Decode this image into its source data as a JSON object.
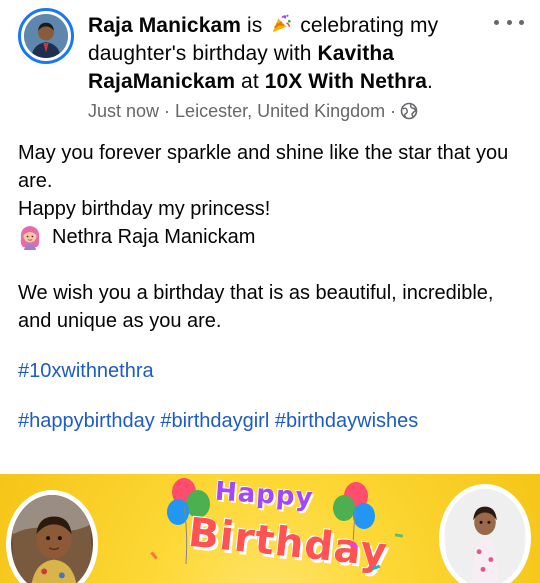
{
  "header": {
    "author": "Raja Manickam",
    "connector_is": " is ",
    "activity": " celebrating my daughter's birthday with ",
    "tagged_person": "Kavitha RajaManickam",
    "connector_at": " at ",
    "place": "10X With Nethra",
    "period": ".",
    "activity_icon": "party-popper-icon",
    "time": "Just now",
    "separator": " · ",
    "location": "Leicester, United Kingdom",
    "separator2": " ·",
    "audience_icon": "globe-icon",
    "more_icon": "more-options-icon"
  },
  "body": {
    "line1": "May you forever sparkle and shine like the star that you are.",
    "line2": "Happy birthday my princess!",
    "line3_icon": "girl-emoji-icon",
    "line3": "Nethra Raja Manickam",
    "line4": "We wish you a birthday that is as beautiful, incredible, and unique as you are.",
    "hashtag1": "#10xwithnethra",
    "hashtags": [
      "#happybirthday",
      "#birthdaygirl",
      "#birthdaywishes"
    ]
  },
  "image": {
    "happy": "Happy",
    "birthday": "Birthday",
    "colors": {
      "background": "#fdd835",
      "happy": "#a347ff",
      "birthday": "#ff5252"
    }
  },
  "colors": {
    "link": "#1d5bc9",
    "meta": "#65676b",
    "accent": "#1877f2"
  }
}
